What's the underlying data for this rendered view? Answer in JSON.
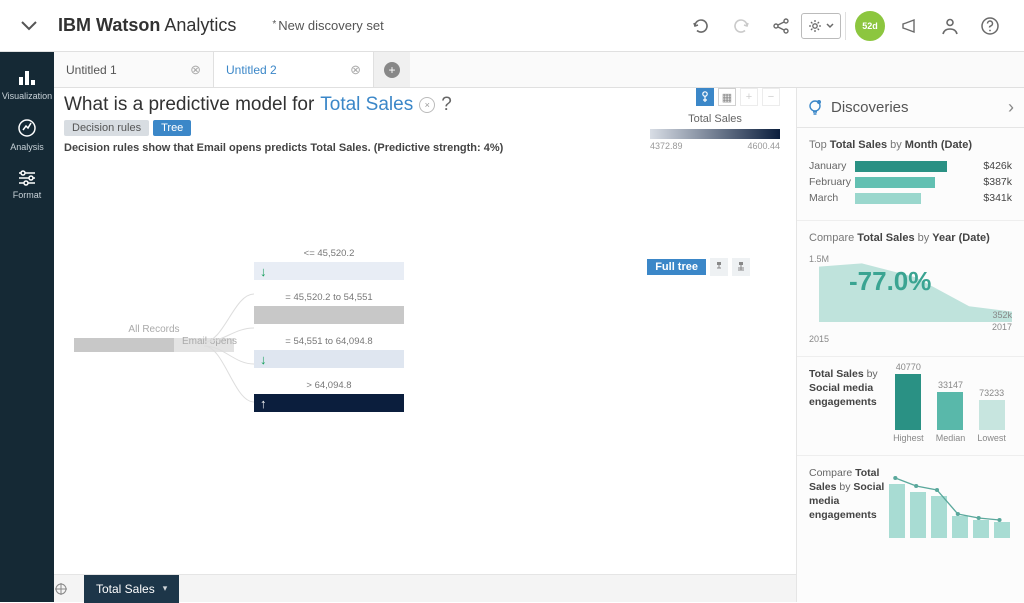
{
  "header": {
    "brand_bold": "IBM Watson",
    "brand_light": " Analytics",
    "doc_name": "New discovery set",
    "trial_badge": "52d"
  },
  "leftrail": {
    "visualization": "Visualization",
    "analysis": "Analysis",
    "format": "Format"
  },
  "tabs": {
    "t1": "Untitled 1",
    "t2": "Untitled 2"
  },
  "question": {
    "prefix": "What is a predictive model for",
    "metric": "Total Sales",
    "qmark": "?"
  },
  "pills": {
    "rules": "Decision rules",
    "tree": "Tree"
  },
  "explain": "Decision rules show that Email opens predicts Total Sales. (Predictive strength: 4%)",
  "root": {
    "label": "All Records",
    "split_field": "Email opens"
  },
  "legend": {
    "title": "Total Sales",
    "min": "4372.89",
    "max": "4600.44"
  },
  "fulltree": {
    "label": "Full tree"
  },
  "discoveries": {
    "title": "Discoveries"
  },
  "card1": {
    "title_pre": "Top ",
    "title_b": "Total Sales",
    "title_mid": " by ",
    "title_b2": "Month (Date)",
    "rows": [
      {
        "m": "January",
        "v": "$426k"
      },
      {
        "m": "February",
        "v": "$387k"
      },
      {
        "m": "March",
        "v": "$341k"
      }
    ]
  },
  "card2": {
    "title_pre": "Compare ",
    "title_b": "Total Sales",
    "title_mid": " by ",
    "title_b2": "Year (Date)",
    "ylab": "1.5M",
    "x0": "2015",
    "x1": "2017",
    "rlab": "352k",
    "big": "-77.0%"
  },
  "card3": {
    "left_b1": "Total Sales",
    "left_mid": " by ",
    "left_b2": "Social media engagements",
    "bars": [
      {
        "v": "40770",
        "l": "Highest"
      },
      {
        "v": "33147",
        "l": "Median"
      },
      {
        "v": "73233",
        "l": "Lowest"
      }
    ]
  },
  "card4": {
    "left_pre": "Compare ",
    "left_b1": "Total Sales",
    "left_mid": " by ",
    "left_b2": "Social media engagements"
  },
  "shelf": {
    "metric": "Total Sales"
  },
  "chart_data": [
    {
      "type": "bar",
      "title": "Top Total Sales by Month (Date)",
      "categories": [
        "January",
        "February",
        "March"
      ],
      "values": [
        426000,
        387000,
        341000
      ],
      "xlabel": "",
      "ylabel": "Total Sales"
    },
    {
      "type": "area",
      "title": "Compare Total Sales by Year (Date)",
      "x": [
        2015,
        2017
      ],
      "values": [
        1500000,
        352000
      ],
      "annotation": "-77.0%",
      "ylim": [
        0,
        1500000
      ]
    },
    {
      "type": "bar",
      "title": "Total Sales by Social media engagements",
      "categories": [
        "Highest",
        "Median",
        "Lowest"
      ],
      "values": [
        40770,
        33147,
        73233
      ]
    },
    {
      "type": "table",
      "title": "Decision tree splits on Email opens → Total Sales",
      "rows": [
        {
          "condition": "<= 45,520.2",
          "direction": "down"
        },
        {
          "condition": "= 45,520.2 to 54,551",
          "direction": "flat"
        },
        {
          "condition": "= 54,551 to 64,094.8",
          "direction": "down"
        },
        {
          "condition": "> 64,094.8",
          "direction": "up"
        }
      ],
      "legend_min": 4372.89,
      "legend_max": 4600.44
    }
  ]
}
